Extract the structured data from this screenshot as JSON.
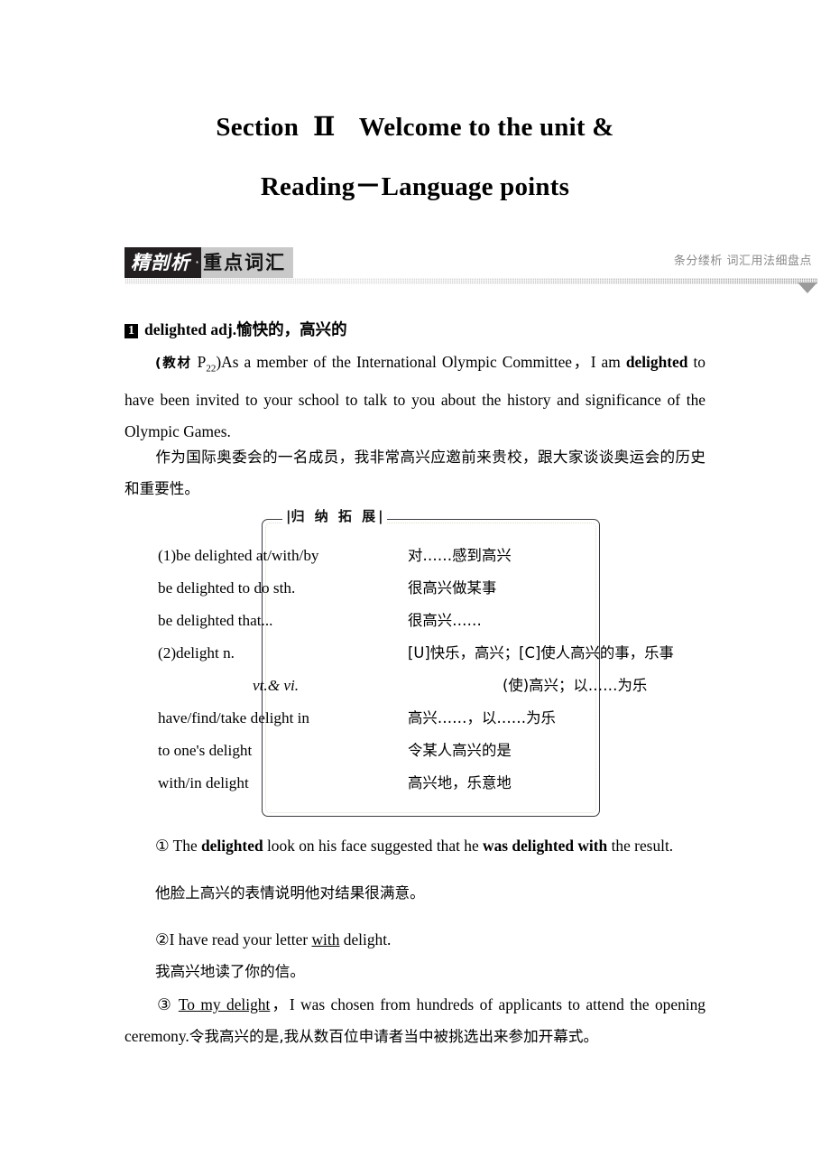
{
  "title": {
    "line1_prefix": "Section",
    "line1_roman": "Ⅱ",
    "line1_rest": "Welcome to the unit &",
    "line2": "Reading－Language points"
  },
  "banner": {
    "tag_dark": "精剖析",
    "tag_dot": "·",
    "tag_grey": "重点词汇",
    "right_note": "条分缕析 词汇用法细盘点",
    "accent_dark": "#231f20",
    "accent_grey": "#c9c9c9",
    "note_color": "#8a8a8a"
  },
  "entry": {
    "number": "1",
    "headword": "delighted adj.愉快的，高兴的",
    "source_label": "(教材",
    "source_page_p": "P",
    "source_page_num": "22",
    "source_close": ")",
    "example_en_a": "As a member of the International Olympic Committee，I am ",
    "example_en_bold": "delighted",
    "example_en_b": " to have been invited to your school to talk to you about the history and significance of the Olympic Games.",
    "example_cn": "作为国际奥委会的一名成员，我非常高兴应邀前来贵校，跟大家谈谈奥运会的历史和重要性。"
  },
  "gnbox": {
    "label_open": "|",
    "label": "归 纳 拓 展",
    "label_close": "|",
    "rows": [
      {
        "en": "(1)be delighted at/with/by",
        "cn": "对……感到高兴",
        "indent": false,
        "italic": false
      },
      {
        "en": "be delighted to do sth.",
        "cn": "很高兴做某事",
        "indent": false,
        "italic": false
      },
      {
        "en": "be delighted that...",
        "cn": "很高兴……",
        "indent": false,
        "italic": false
      },
      {
        "en": "(2)delight n.",
        "cn": "[U]快乐，高兴；[C]使人高兴的事，乐事",
        "indent": false,
        "italic": true
      },
      {
        "en": "vt.& vi.",
        "cn": "(使)高兴；以……为乐",
        "indent": true,
        "italic": true
      },
      {
        "en": "have/find/take delight in",
        "cn": "高兴……，以……为乐",
        "indent": false,
        "italic": false
      },
      {
        "en": "to one's delight",
        "cn": "令某人高兴的是",
        "indent": false,
        "italic": false
      },
      {
        "en": "with/in delight",
        "cn": "高兴地，乐意地",
        "indent": false,
        "italic": false
      }
    ]
  },
  "examples": [
    {
      "marker": "①",
      "en_1": " The ",
      "en_bold_1": "delighted",
      "en_2": " look on his face suggested that he ",
      "en_bold_2": "was delighted with",
      "en_3": " the result.",
      "cn": "他脸上高兴的表情说明他对结果很满意。"
    },
    {
      "marker": "②",
      "en_1": "I have read your letter ",
      "en_underline": "with",
      "en_2": " delight.",
      "cn": "我高兴地读了你的信。"
    },
    {
      "marker": "③",
      "en_underline": "To my delight",
      "en_1": "，I was chosen from hundreds of applicants to attend the opening ceremony.",
      "cn": "令我高兴的是,我从数百位申请者当中被挑选出来参加开幕式。"
    }
  ]
}
